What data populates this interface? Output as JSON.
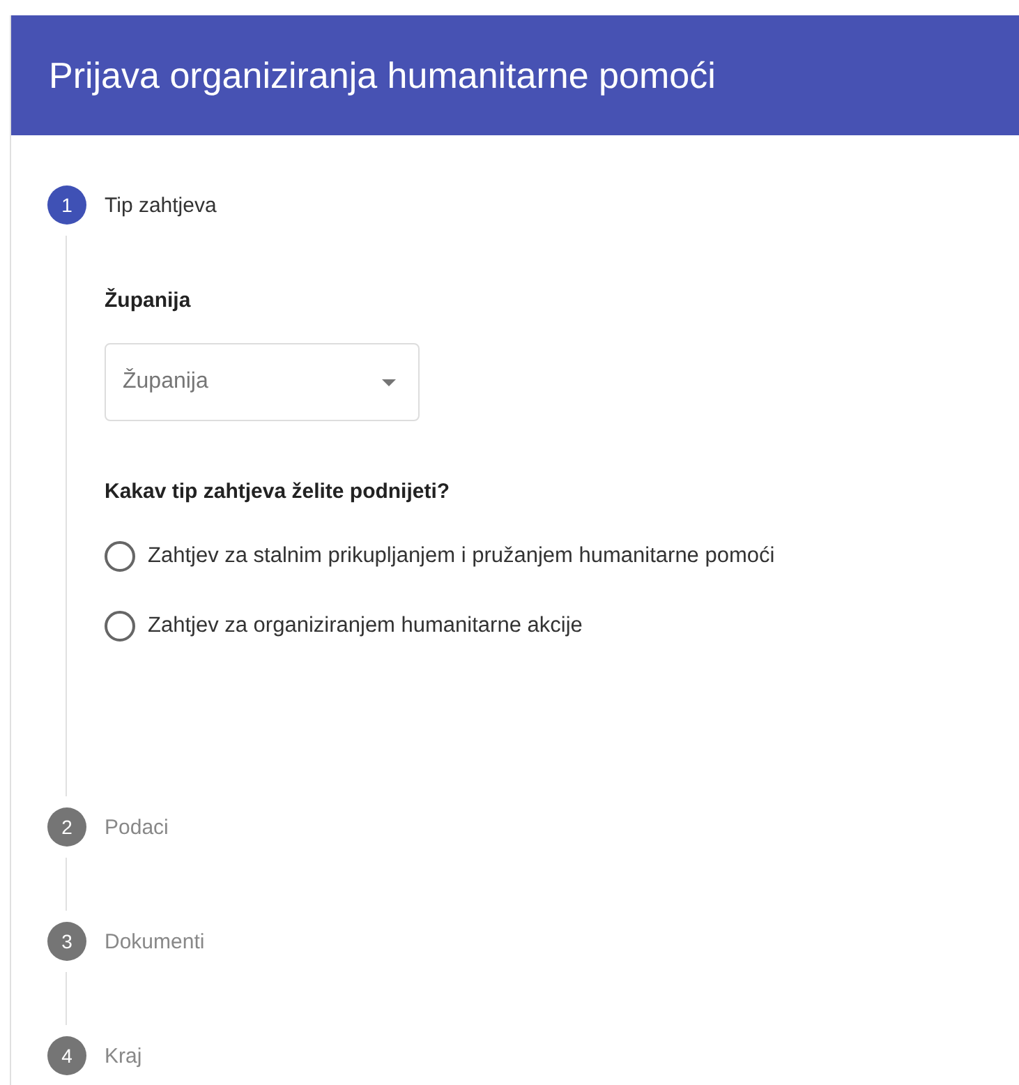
{
  "header": {
    "title": "Prijava organiziranja humanitarne pomoći"
  },
  "steps": [
    {
      "number": "1",
      "label": "Tip zahtjeva",
      "selected": true
    },
    {
      "number": "2",
      "label": "Podaci",
      "selected": false
    },
    {
      "number": "3",
      "label": "Dokumenti",
      "selected": false
    },
    {
      "number": "4",
      "label": "Kraj",
      "selected": false
    }
  ],
  "form": {
    "county_label": "Županija",
    "county_select": {
      "placeholder": "Županija"
    },
    "question": "Kakav tip zahtjeva želite podnijeti?",
    "options": [
      {
        "label": "Zahtjev za stalnim prikupljanjem i pružanjem humanitarne pomoći",
        "selected": false
      },
      {
        "label": "Zahtjev za organiziranjem humanitarne akcije",
        "selected": false
      }
    ]
  }
}
